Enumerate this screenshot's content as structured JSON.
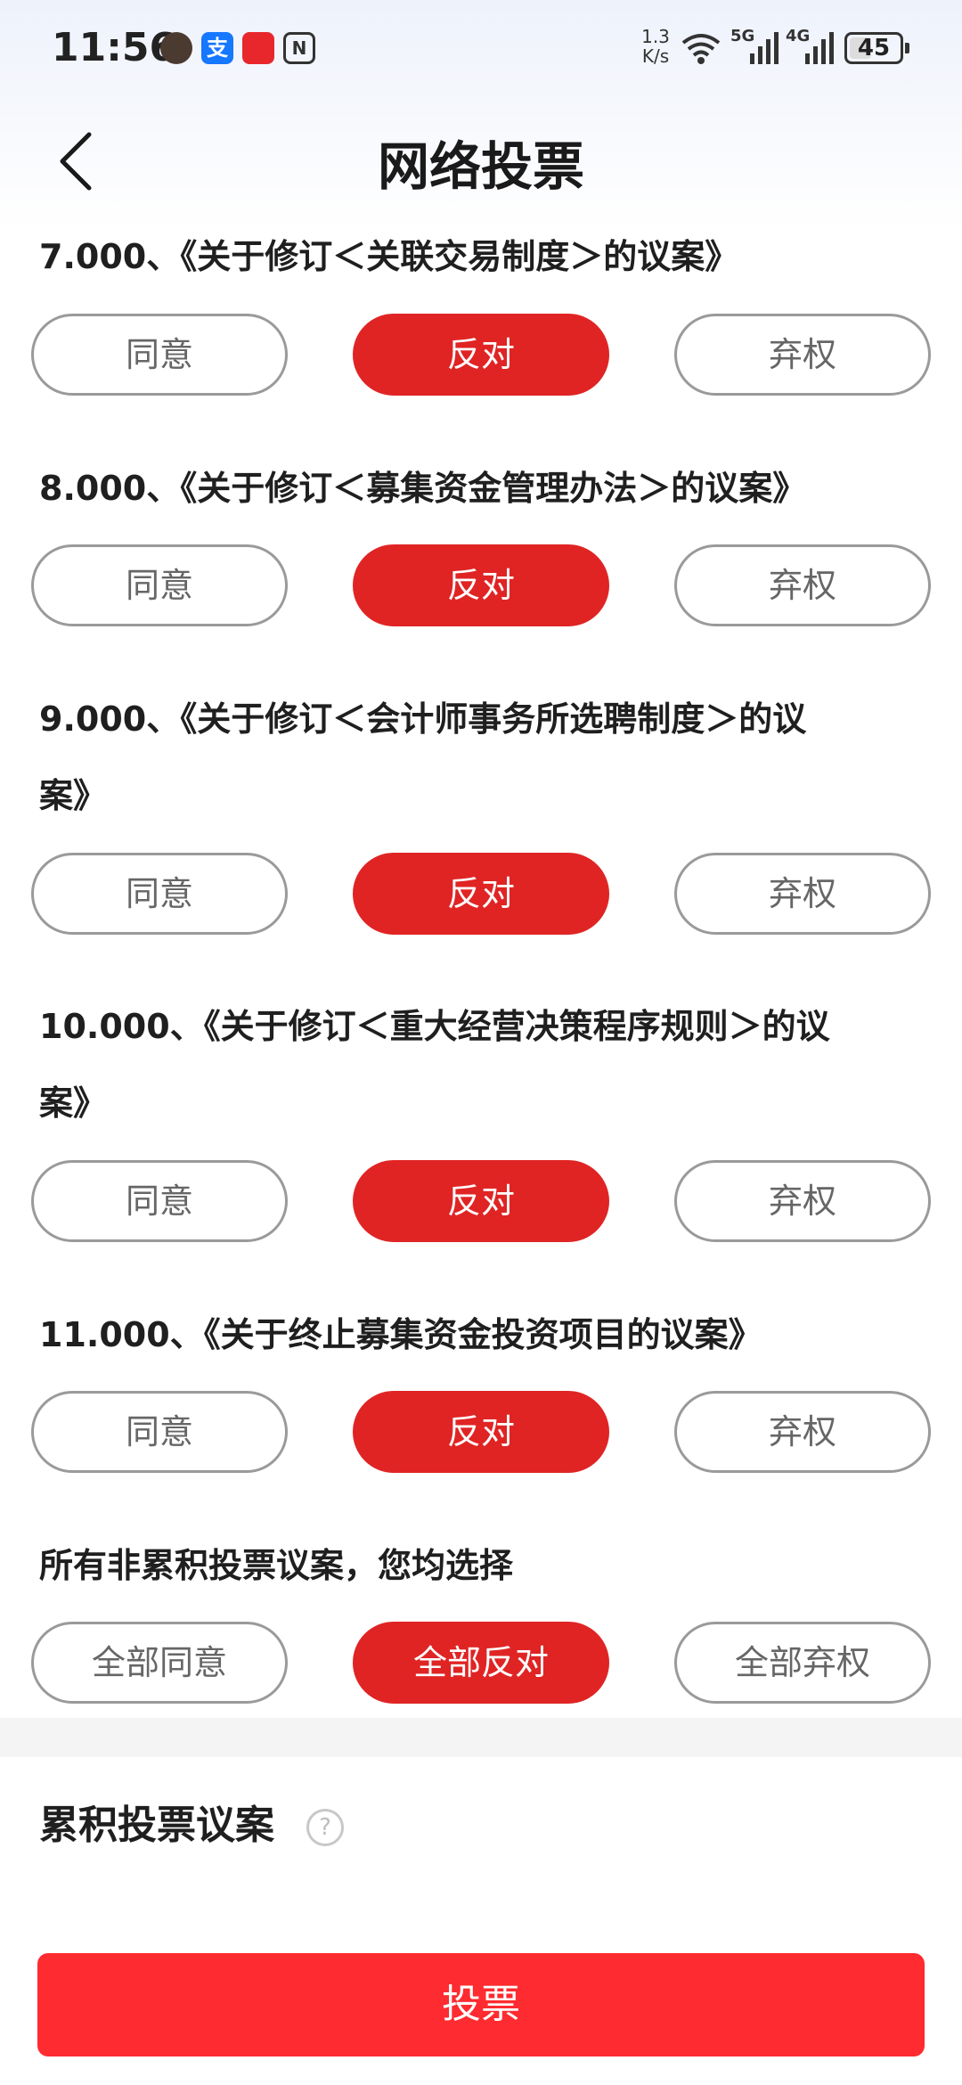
{
  "status_bar": {
    "time": "11:56",
    "alipay_glyph": "支",
    "net_speed_value": "1.3",
    "net_speed_unit": "K/s",
    "signal1_label": "5G",
    "signal2_label": "4G",
    "battery": "45"
  },
  "header": {
    "title": "网络投票"
  },
  "proposals": [
    {
      "title": "7.000、《关于修订＜关联交易制度＞的议案》",
      "options": [
        "同意",
        "反对",
        "弃权"
      ],
      "selected": "反对"
    },
    {
      "title": "8.000、《关于修订＜募集资金管理办法＞的议案》",
      "options": [
        "同意",
        "反对",
        "弃权"
      ],
      "selected": "反对"
    },
    {
      "title_line1": "9.000、《关于修订＜会计师事务所选聘制度＞的议",
      "title_line2": "案》",
      "options": [
        "同意",
        "反对",
        "弃权"
      ],
      "selected": "反对"
    },
    {
      "title_line1": "10.000、《关于修订＜重大经营决策程序规则＞的议",
      "title_line2": "案》",
      "options": [
        "同意",
        "反对",
        "弃权"
      ],
      "selected": "反对"
    },
    {
      "title": "11.000、《关于终止募集资金投资项目的议案》",
      "options": [
        "同意",
        "反对",
        "弃权"
      ],
      "selected": "反对"
    }
  ],
  "bulk": {
    "prompt": "所有非累积投票议案，您均选择",
    "options": [
      "全部同意",
      "全部反对",
      "全部弃权"
    ],
    "selected": "全部反对"
  },
  "cumulative": {
    "title": "累积投票议案",
    "help_glyph": "?"
  },
  "vote_button": "投票",
  "colors": {
    "accent": "#e02424",
    "vote_button": "#fe2b30",
    "unselected_border": "#9a9a9a"
  },
  "icons": {
    "back": "chevron-left-icon",
    "help": "question-circle-icon"
  }
}
